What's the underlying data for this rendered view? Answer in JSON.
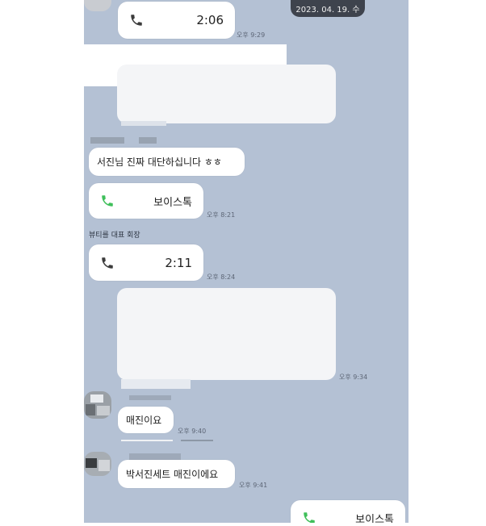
{
  "date_label": "2023. 04. 19. 수",
  "messages": {
    "call_1": {
      "duration": "2:06",
      "time": "오후 9:29"
    },
    "text_1": {
      "text": "서진님 진짜 대단하십니다 ㅎㅎ"
    },
    "voicetalk_1": {
      "label": "보이스톡",
      "time": "오후 8:21"
    },
    "sender_1": "뷰티를 대표 회장",
    "call_2": {
      "duration": "2:11",
      "time": "오후 8:24"
    },
    "image_time": "오후 9:34",
    "text_2": {
      "text": "매진이요",
      "time": "오후 9:40"
    },
    "text_3": {
      "text": "박서진세트 매진이에요",
      "time": "오후 9:41"
    },
    "voicetalk_2": {
      "label": "보이스톡"
    }
  },
  "colors": {
    "chat_bg": "#b4c1d4",
    "call_icon_dark": "#3b3b3b",
    "call_icon_green": "#3fbf5a",
    "bubble": "#ffffff"
  },
  "icons": {
    "call_icon": "phone-icon",
    "voice_icon": "phone-green-icon"
  }
}
